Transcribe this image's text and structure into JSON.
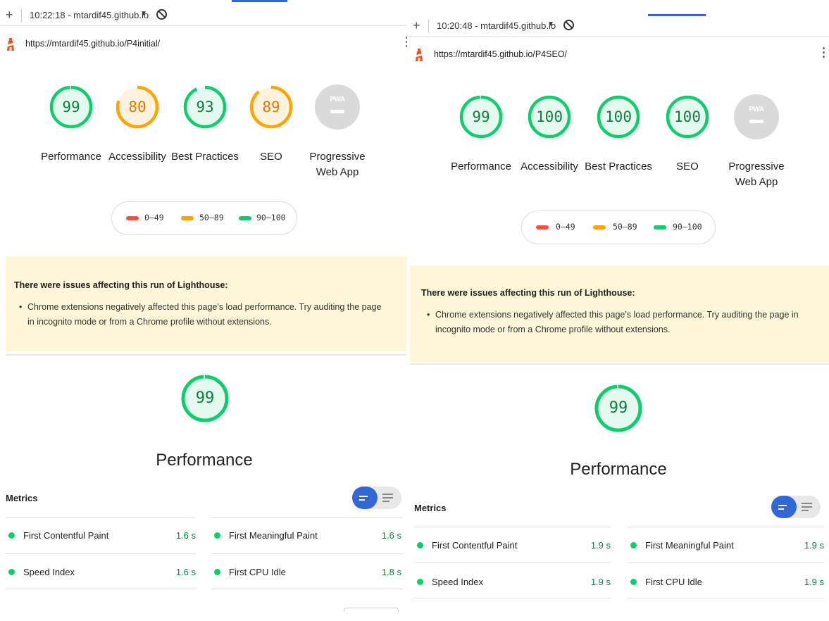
{
  "colors": {
    "pass": "#0cce6b",
    "pass_text": "#0b8043",
    "average": "#ffa400",
    "average_text": "#e67700",
    "fail": "#ff4e42",
    "pwa_gray": "#dadada",
    "accent": "#3367d6",
    "warning_bg": "#fef6d9"
  },
  "left": {
    "run_label": "10:22:18 - mtardif45.github.io",
    "url": "https://mtardif45.github.io/P4initial/",
    "gauges": [
      {
        "score": "99",
        "label": "Performance",
        "rating": "pass",
        "pct": 0.99
      },
      {
        "score": "80",
        "label": "Accessibility",
        "rating": "average",
        "pct": 0.8
      },
      {
        "score": "93",
        "label": "Best Practices",
        "rating": "pass",
        "pct": 0.93
      },
      {
        "score": "89",
        "label": "SEO",
        "rating": "average",
        "pct": 0.89
      }
    ],
    "pwa": {
      "badge": "PWA",
      "label": "Progressive Web App"
    },
    "legend": [
      "0–49",
      "50–89",
      "90–100"
    ],
    "warning_title": "There were issues affecting this run of Lighthouse:",
    "warning_text": "Chrome extensions negatively affected this page's load performance. Try auditing the page in incognito mode or from a Chrome profile without extensions.",
    "perf_score": "99",
    "perf_title": "Performance",
    "metrics_title": "Metrics",
    "metrics": [
      {
        "name": "First Contentful Paint",
        "value": "1.6 s"
      },
      {
        "name": "First Meaningful Paint",
        "value": "1.6 s"
      },
      {
        "name": "Speed Index",
        "value": "1.6 s"
      },
      {
        "name": "First CPU Idle",
        "value": "1.8 s"
      }
    ]
  },
  "right": {
    "run_label": "10:20:48 - mtardif45.github.io",
    "url": "https://mtardif45.github.io/P4SEO/",
    "gauges": [
      {
        "score": "99",
        "label": "Performance",
        "rating": "pass",
        "pct": 0.99
      },
      {
        "score": "100",
        "label": "Accessibility",
        "rating": "pass",
        "pct": 1.0
      },
      {
        "score": "100",
        "label": "Best Practices",
        "rating": "pass",
        "pct": 1.0
      },
      {
        "score": "100",
        "label": "SEO",
        "rating": "pass",
        "pct": 1.0
      }
    ],
    "pwa": {
      "badge": "PWA",
      "label": "Progressive Web App"
    },
    "legend": [
      "0–49",
      "50–89",
      "90–100"
    ],
    "warning_title": "There were issues affecting this run of Lighthouse:",
    "warning_text": "Chrome extensions negatively affected this page's load performance. Try auditing the page in incognito mode or from a Chrome profile without extensions.",
    "perf_score": "99",
    "perf_title": "Performance",
    "metrics_title": "Metrics",
    "metrics": [
      {
        "name": "First Contentful Paint",
        "value": "1.9 s"
      },
      {
        "name": "First Meaningful Paint",
        "value": "1.9 s"
      },
      {
        "name": "Speed Index",
        "value": "1.9 s"
      },
      {
        "name": "First CPU Idle",
        "value": "1.9 s"
      }
    ]
  }
}
